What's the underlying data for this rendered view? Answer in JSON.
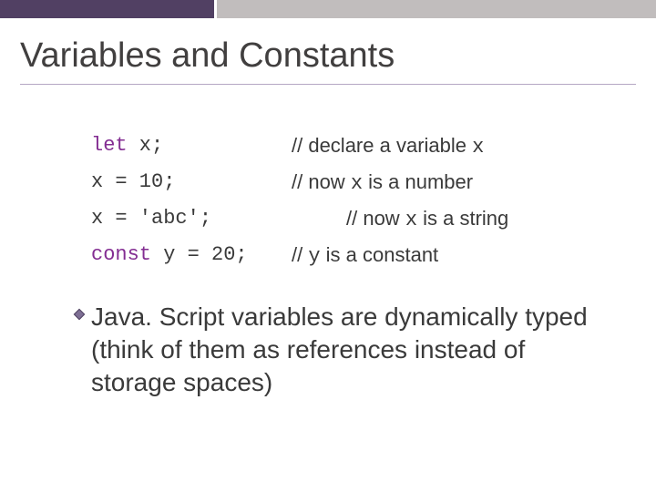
{
  "title": "Variables and Constants",
  "rows": [
    {
      "kwd": "let",
      "rest": " x;",
      "comment_prefix": "// declare a variable ",
      "comment_code": "x",
      "comment_suffix": ""
    },
    {
      "kwd": "",
      "rest": "x = 10;",
      "comment_prefix": "// now ",
      "comment_code": "x",
      "comment_suffix": " is a number"
    },
    {
      "kwd": "",
      "rest": "x = 'abc';",
      "comment_prefix": "// now ",
      "comment_code": "x",
      "comment_suffix": " is a string",
      "indent": true
    },
    {
      "kwd": "const",
      "rest": " y = 20;",
      "comment_prefix": "// ",
      "comment_code": "y",
      "comment_suffix": " is a constant"
    }
  ],
  "bullet": "Java. Script variables are dynamically typed (think of them as references instead of storage spaces)"
}
